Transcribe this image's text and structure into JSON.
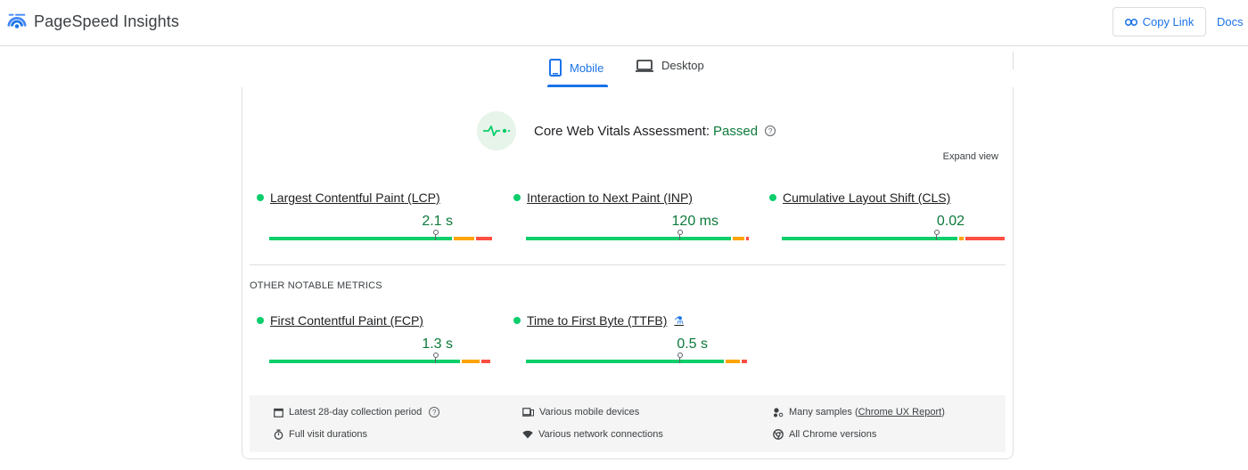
{
  "header": {
    "app_name": "PageSpeed Insights",
    "copy_link_label": "Copy Link",
    "docs_label": "Docs"
  },
  "tabs": [
    {
      "label": "Mobile",
      "active": true
    },
    {
      "label": "Desktop",
      "active": false
    }
  ],
  "assessment": {
    "label": "Core Web Vitals Assessment:",
    "status": "Passed",
    "expand_label": "Expand view"
  },
  "core_metrics": [
    {
      "name": "Largest Contentful Paint (LCP)",
      "value": "2.1 s"
    },
    {
      "name": "Interaction to Next Paint (INP)",
      "value": "120 ms"
    },
    {
      "name": "Cumulative Layout Shift (CLS)",
      "value": "0.02"
    }
  ],
  "other_section_label": "OTHER NOTABLE METRICS",
  "other_metrics": [
    {
      "name": "First Contentful Paint (FCP)",
      "value": "1.3 s"
    },
    {
      "name": "Time to First Byte (TTFB)",
      "value": "0.5 s"
    }
  ],
  "footer": {
    "collection_period": "Latest 28-day collection period",
    "devices": "Various mobile devices",
    "samples_prefix": "Many samples (",
    "samples_link": "Chrome UX Report",
    "samples_suffix": ")",
    "durations": "Full visit durations",
    "network": "Various network connections",
    "chrome_versions": "All Chrome versions"
  },
  "colors": {
    "accent": "#1a73e8",
    "good": "#0cce6b",
    "needs_improvement": "#ffa400",
    "poor": "#ff4e42",
    "good_text": "#0d7a3b"
  }
}
